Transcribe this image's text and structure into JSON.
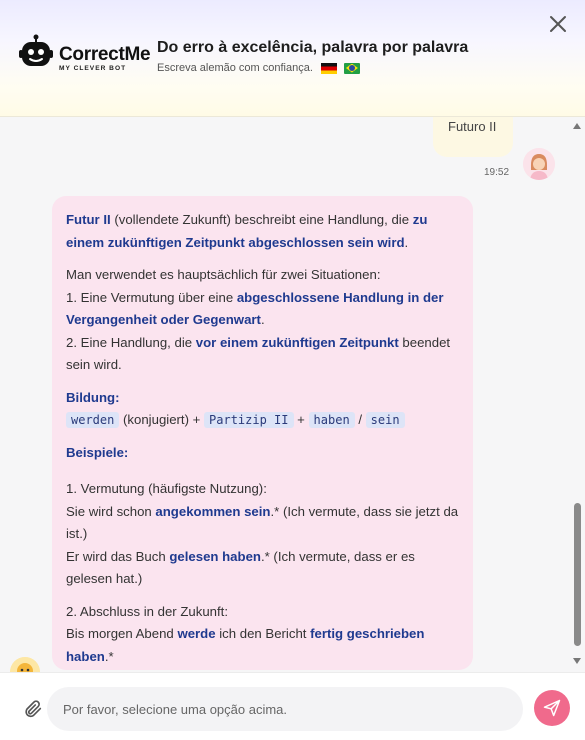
{
  "header": {
    "logo_name": "CorrectMe",
    "logo_tagline": "MY CLEVER BOT",
    "title": "Do erro à excelência, palavra por palavra",
    "subtitle": "Escreva alemão com confiança."
  },
  "chat": {
    "user_message": {
      "text": "Futuro II",
      "time": "19:52"
    },
    "bot_message": {
      "p1": {
        "term": "Futur II",
        "text_a": " (vollendete Zukunft) beschreibt eine Handlung, die ",
        "hl": "zu einem zukünftigen Zeitpunkt abgeschlossen sein wird",
        "text_b": "."
      },
      "p2": {
        "intro": "Man verwendet es hauptsächlich für zwei Situationen:",
        "item1_a": "1. Eine Vermutung über eine ",
        "item1_hl": "abgeschlossene Handlung in der Vergangenheit oder Gegenwart",
        "item1_b": ".",
        "item2_a": "2. Eine Handlung, die ",
        "item2_hl": "vor einem zukünftigen Zeitpunkt",
        "item2_b": " beendet sein wird."
      },
      "bildung": {
        "heading": "Bildung:",
        "code1": "werden",
        "text1": " (konjugiert) + ",
        "code2": "Partizip II",
        "text2": " + ",
        "code3": "haben",
        "slash": " / ",
        "code4": "sein"
      },
      "beispiele": {
        "heading": "Beispiele:",
        "ex1_title": "1. Vermutung (häufigste Nutzung):",
        "ex1a_a": "Sie wird schon ",
        "ex1a_hl": "angekommen sein",
        "ex1a_b": ".* (Ich vermute, dass sie jetzt da ist.)",
        "ex1b_a": "Er wird das Buch ",
        "ex1b_hl": "gelesen haben",
        "ex1b_b": ".* (Ich vermute, dass er es gelesen hat.)",
        "ex2_title": "2. Abschluss in der Zukunft:",
        "ex2_a": "Bis morgen Abend ",
        "ex2_hl1": "werde",
        "ex2_b": " ich den Bericht ",
        "ex2_hl2": "fertig geschrieben haben",
        "ex2_c": ".*"
      }
    }
  },
  "input": {
    "placeholder": "Por favor, selecione uma opção acima."
  },
  "colors": {
    "accent": "#f06a8c",
    "highlight_text": "#1f3a8f",
    "bot_bubble": "#fbe4ef",
    "user_bubble": "#fdf8e3"
  },
  "icons": [
    "robot-logo-icon",
    "close-icon",
    "attach-paperclip-icon",
    "send-icon",
    "flag-germany-icon",
    "flag-brazil-icon"
  ]
}
